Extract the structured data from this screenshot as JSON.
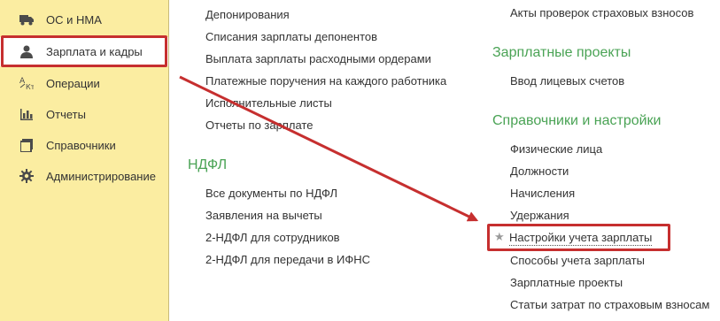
{
  "sidebar": {
    "items": [
      {
        "label": "ОС и НМА",
        "icon": "truck-icon"
      },
      {
        "label": "Зарплата и кадры",
        "icon": "person-icon"
      },
      {
        "label": "Операции",
        "icon": "operations-icon"
      },
      {
        "label": "Отчеты",
        "icon": "bar-chart-icon"
      },
      {
        "label": "Справочники",
        "icon": "book-icon"
      },
      {
        "label": "Администрирование",
        "icon": "gear-icon"
      }
    ]
  },
  "col1": {
    "links_top": [
      "Депонирования",
      "Списания зарплаты депонентов",
      "Выплата зарплаты расходными ордерами",
      "Платежные поручения на каждого работника",
      "Исполнительные листы",
      "Отчеты по зарплате"
    ],
    "ndfl_heading": "НДФЛ",
    "ndfl_links": [
      "Все документы по НДФЛ",
      "Заявления на вычеты",
      "2-НДФЛ для сотрудников",
      "2-НДФЛ для передачи в ИФНС"
    ]
  },
  "col2": {
    "top_link": "Акты проверок страховых взносов",
    "projects_heading": "Зарплатные проекты",
    "projects_links": [
      "Ввод лицевых счетов"
    ],
    "settings_heading": "Справочники и настройки",
    "settings_links": [
      "Физические лица",
      "Должности",
      "Начисления",
      "Удержания",
      "Настройки учета зарплаты",
      "Способы учета зарплаты",
      "Зарплатные проекты",
      "Статьи затрат по страховым взносам"
    ]
  },
  "colors": {
    "sidebar_bg": "#fbeda1",
    "heading": "#4aa355",
    "annotation": "#c62f2f"
  }
}
